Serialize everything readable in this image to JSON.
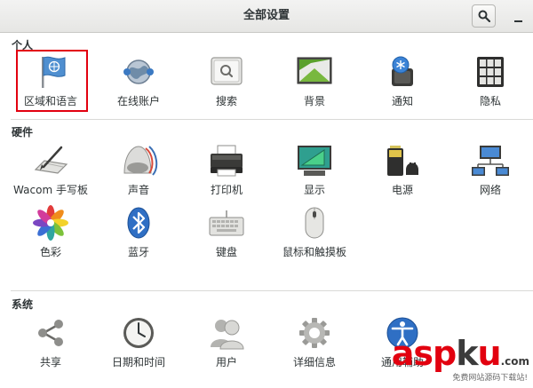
{
  "window": {
    "title": "全部设置"
  },
  "sections": {
    "personal": {
      "title": "个人"
    },
    "hardware": {
      "title": "硬件"
    },
    "system": {
      "title": "系统"
    }
  },
  "personal_items": [
    {
      "label": "区域和语言",
      "icon": "flag-icon"
    },
    {
      "label": "在线账户",
      "icon": "online-accounts-icon"
    },
    {
      "label": "搜索",
      "icon": "search-icon"
    },
    {
      "label": "背景",
      "icon": "background-icon"
    },
    {
      "label": "通知",
      "icon": "notifications-icon"
    },
    {
      "label": "隐私",
      "icon": "privacy-icon"
    }
  ],
  "hardware_items": [
    {
      "label": "Wacom 手写板",
      "icon": "wacom-tablet-icon"
    },
    {
      "label": "声音",
      "icon": "sound-icon"
    },
    {
      "label": "打印机",
      "icon": "printer-icon"
    },
    {
      "label": "显示",
      "icon": "display-icon"
    },
    {
      "label": "电源",
      "icon": "power-icon"
    },
    {
      "label": "网络",
      "icon": "network-icon"
    },
    {
      "label": "色彩",
      "icon": "color-icon"
    },
    {
      "label": "蓝牙",
      "icon": "bluetooth-icon"
    },
    {
      "label": "键盘",
      "icon": "keyboard-icon"
    },
    {
      "label": "鼠标和触摸板",
      "icon": "mouse-icon"
    }
  ],
  "system_items": [
    {
      "label": "共享",
      "icon": "sharing-icon"
    },
    {
      "label": "日期和时间",
      "icon": "clock-icon"
    },
    {
      "label": "用户",
      "icon": "users-icon"
    },
    {
      "label": "详细信息",
      "icon": "details-gear-icon"
    },
    {
      "label": "通用辅助",
      "icon": "accessibility-icon"
    }
  ],
  "watermark": {
    "part1": "asp",
    "part2": "k",
    "part3": "u",
    "suffix": ".com",
    "sub": "免费网站源码下载站!"
  },
  "colors": {
    "highlight": "#e2000f",
    "titlebar": "#e6e6e4",
    "text": "#2e3436"
  }
}
